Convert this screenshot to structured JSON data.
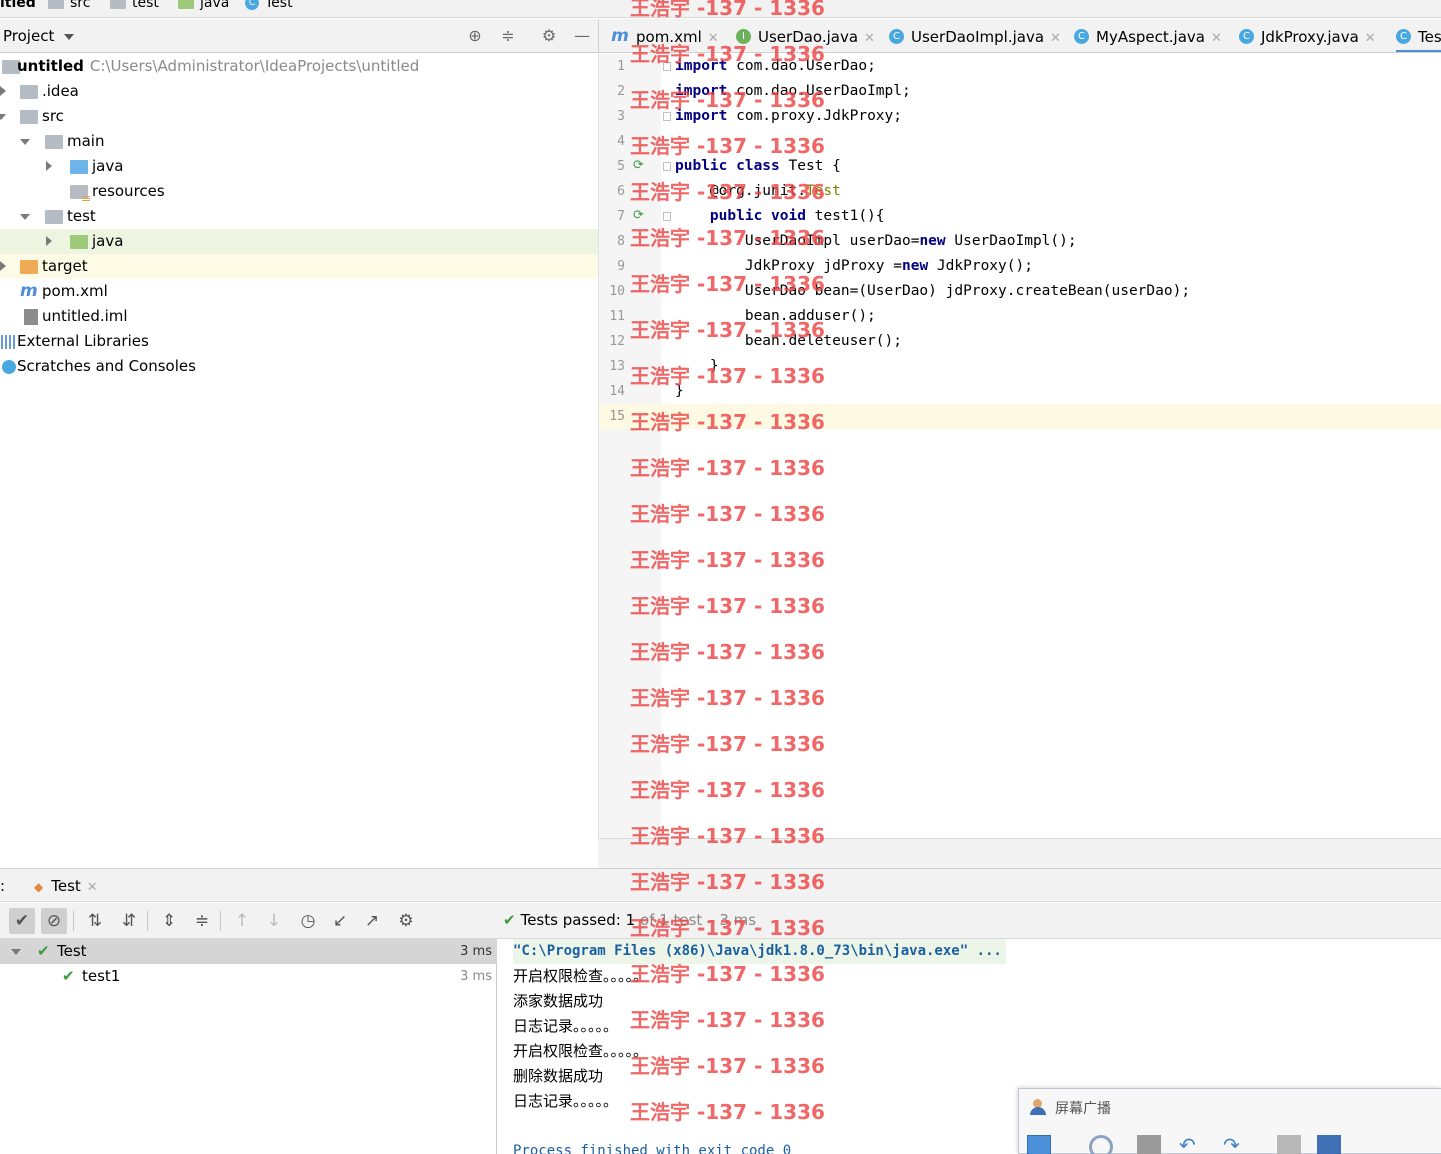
{
  "breadcrumb": [
    "itled",
    "src",
    "test",
    "java",
    "Test"
  ],
  "project_panel": {
    "title": "Project",
    "tree": [
      {
        "label": "untitled",
        "path": "C:\\Users\\Administrator\\IdeaProjects\\untitled"
      },
      {
        "label": ".idea"
      },
      {
        "label": "src"
      },
      {
        "label": "main"
      },
      {
        "label": "java"
      },
      {
        "label": "resources"
      },
      {
        "label": "test"
      },
      {
        "label": "java"
      },
      {
        "label": "target"
      },
      {
        "label": "pom.xml"
      },
      {
        "label": "untitled.iml"
      },
      {
        "label": "External Libraries"
      },
      {
        "label": "Scratches and Consoles"
      }
    ]
  },
  "editor": {
    "tabs": [
      {
        "label": "pom.xml",
        "icon": "maven-icon"
      },
      {
        "label": "UserDao.java",
        "icon": "interface-icon"
      },
      {
        "label": "UserDaoImpl.java",
        "icon": "class-icon"
      },
      {
        "label": "MyAspect.java",
        "icon": "class-icon"
      },
      {
        "label": "JdkProxy.java",
        "icon": "class-icon"
      },
      {
        "label": "Tes",
        "icon": "test-class-icon"
      }
    ],
    "line_numbers": [
      "1",
      "2",
      "3",
      "4",
      "5",
      "6",
      "7",
      "8",
      "9",
      "10",
      "11",
      "12",
      "13",
      "14",
      "15"
    ],
    "code": [
      [
        "import",
        " com.dao.UserDao;"
      ],
      [
        "import",
        " com.dao.UserDaoImpl;"
      ],
      [
        "import",
        " com.proxy.JdkProxy;"
      ],
      [
        "",
        ""
      ],
      [
        "public class",
        " Test {"
      ],
      [
        "    @org.junit.",
        "Test"
      ],
      [
        "    public void",
        " test1(){"
      ],
      [
        "        UserDaoImpl userDao=",
        "new",
        " UserDaoImpl();"
      ],
      [
        "        JdkProxy jdProxy =",
        "new",
        " JdkProxy();"
      ],
      [
        "        UserDao bean=(UserDao) jdProxy.createBean(userDao);"
      ],
      [
        "        bean.adduser();"
      ],
      [
        "        bean.deleteuser();"
      ],
      [
        "    }"
      ],
      [
        "}"
      ],
      [
        ""
      ]
    ]
  },
  "run_panel": {
    "label": ":",
    "tab_label": "Test",
    "status_prefix": "Tests passed:",
    "status_count": "1",
    "status_detail": "of 1 test – 3 ms",
    "tree": [
      {
        "label": "Test",
        "time": "3 ms"
      },
      {
        "label": "test1",
        "time": "3 ms"
      }
    ],
    "console": [
      "\"C:\\Program Files (x86)\\Java\\jdk1.8.0_73\\bin\\java.exe\" ...",
      "开启权限检查。。。。。",
      "添家数据成功",
      "日志记录。。。。。",
      "开启权限检查。。。。。",
      "删除数据成功",
      "日志记录。。。。。",
      "",
      "Process finished with exit code 0"
    ]
  },
  "broadcast": {
    "title": "屏幕广播"
  },
  "watermark": "王浩宇 -137 - 1336"
}
